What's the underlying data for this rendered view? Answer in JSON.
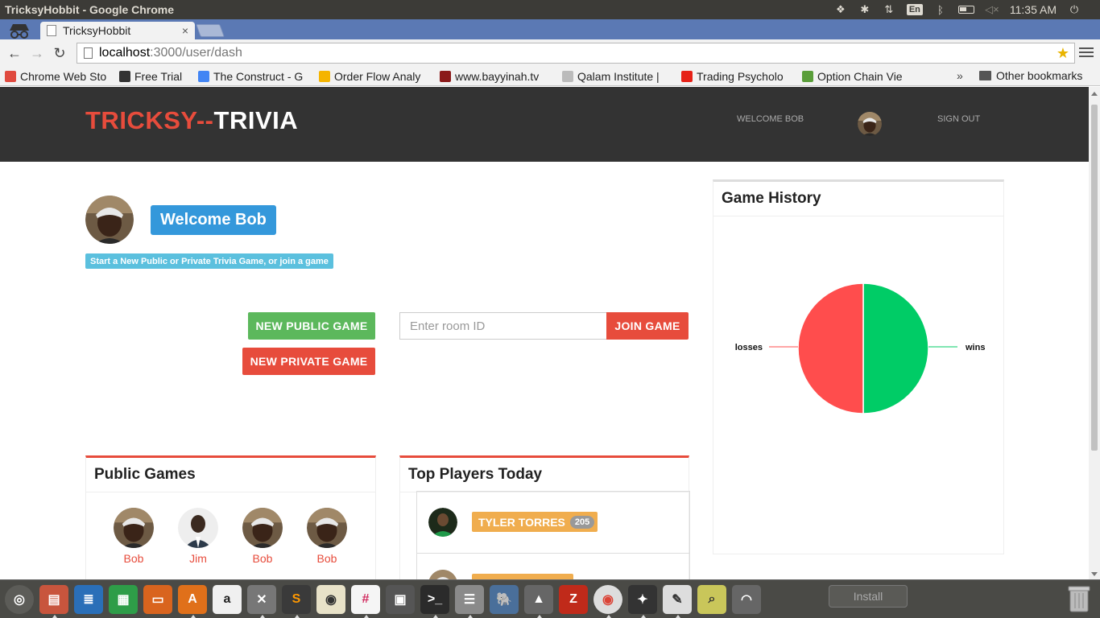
{
  "os": {
    "window_title": "TricksyHobbit - Google Chrome",
    "keyboard_layout": "En",
    "clock": "11:35 AM"
  },
  "browser": {
    "tab_title": "TricksyHobbit",
    "tab_close": "×",
    "url_host": "localhost",
    "url_path": ":3000/user/dash",
    "bookmarks": [
      {
        "label": "Chrome Web Sto",
        "icon": "chrome-store-icon",
        "color": "#e04a3f"
      },
      {
        "label": "Free Trial",
        "icon": "flag-icon",
        "color": "#333333"
      },
      {
        "label": "The Construct - G",
        "icon": "docs-icon",
        "color": "#4285f4"
      },
      {
        "label": "Order Flow Analy",
        "icon": "circle-icon",
        "color": "#f5b400"
      },
      {
        "label": "www.bayyinah.tv",
        "icon": "bayyinah-icon",
        "color": "#8b1a1a"
      },
      {
        "label": "Qalam Institute |",
        "icon": "feather-icon",
        "color": "#bbbbbb"
      },
      {
        "label": "Trading Psycholo",
        "icon": "youtube-icon",
        "color": "#e62117"
      },
      {
        "label": "Option Chain Vie",
        "icon": "check-icon",
        "color": "#5a9e3a"
      }
    ],
    "bookmarks_overflow": "»",
    "other_bookmarks": "Other bookmarks"
  },
  "app": {
    "brand_part1": "TRICKSY",
    "brand_sep": "--",
    "brand_part2": "TRIVIA",
    "header_welcome": "WELCOME BOB",
    "sign_out": "SIGN OUT",
    "welcome_badge": "Welcome Bob",
    "subtitle": "Start a New Public or Private Trivia Game, or join a game",
    "new_public_game": "NEW PUBLIC GAME",
    "new_private_game": "NEW PRIVATE GAME",
    "room_placeholder": "Enter room ID",
    "join_game": "JOIN GAME",
    "public_games_title": "Public Games",
    "public_games": [
      {
        "name": "Bob"
      },
      {
        "name": "Jim"
      },
      {
        "name": "Bob"
      },
      {
        "name": "Bob"
      }
    ],
    "top_players_title": "Top Players Today",
    "top_players": [
      {
        "name": "TYLER TORRES",
        "score": "205"
      }
    ],
    "history_title": "Game History"
  },
  "chart_data": {
    "type": "pie",
    "title": "Game History",
    "categories": [
      "wins",
      "losses"
    ],
    "values": [
      1,
      1
    ],
    "colors": [
      "#00cc66",
      "#ff4d4d"
    ]
  },
  "dock": {
    "install_label": "Install"
  }
}
